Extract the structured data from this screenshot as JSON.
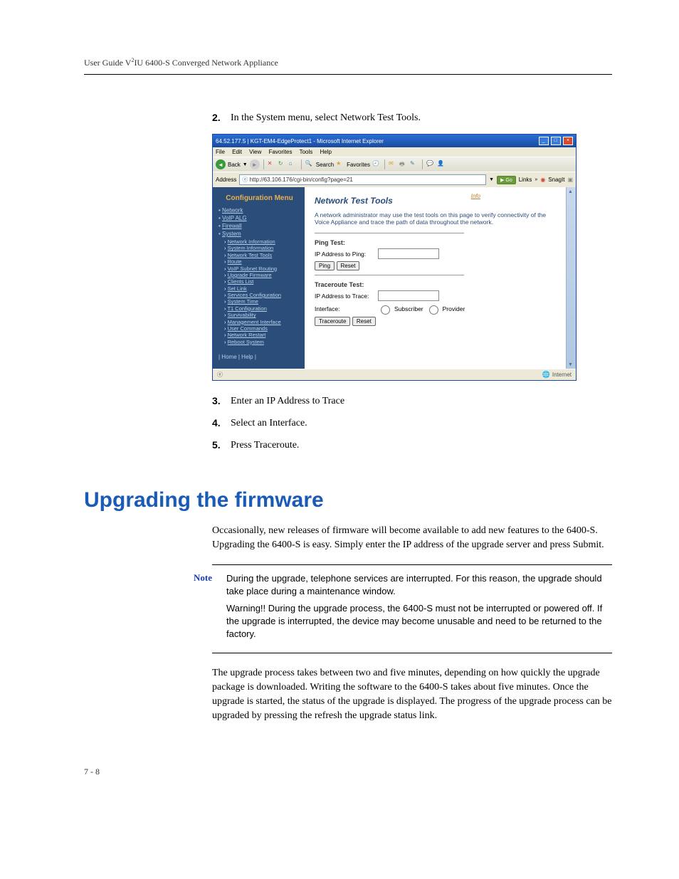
{
  "header": {
    "prefix": "User Guide V",
    "sup": "2",
    "suffix": "IU 6400-S Converged Network Appliance"
  },
  "steps_a": [
    {
      "num": "2.",
      "text": "In the System menu, select Network Test Tools."
    }
  ],
  "steps_b": [
    {
      "num": "3.",
      "text": "Enter an IP Address to Trace"
    },
    {
      "num": "4.",
      "text": "Select an Interface."
    },
    {
      "num": "5.",
      "text": "Press Traceroute."
    }
  ],
  "screenshot": {
    "titlebar": "64.52.177.5 | KGT-EM4-EdgeProtect1 - Microsoft Internet Explorer",
    "menu": {
      "file": "File",
      "edit": "Edit",
      "view": "View",
      "favorites": "Favorites",
      "tools": "Tools",
      "help": "Help"
    },
    "toolbar": {
      "back": "Back",
      "search": "Search",
      "favorites": "Favorites"
    },
    "addressbar": {
      "label": "Address",
      "url": "http://63.106.176/cgi-bin/config?page=21",
      "go": "Go",
      "links": "Links",
      "ext": "SnagIt"
    },
    "sidebar": {
      "title": "Configuration Menu",
      "items": {
        "network": "Network",
        "voip": "VoIP ALG",
        "firewall": "Firewall",
        "system": "System"
      },
      "subs": {
        "netinfo": "Network Information",
        "sysinfo": "System Information",
        "nettest": "Network Test Tools",
        "route": "Route",
        "voip_subnet": "VoIP Subnet Routing",
        "upgrade": "Upgrade Firmware",
        "clients": "Clients List",
        "setlink": "Set Link",
        "services": "Services Configuration",
        "systime": "System Time",
        "t1conf": "T1 Configuration",
        "survive": "Survivability",
        "mgmt": "Management Interface",
        "usercmd": "User Commands",
        "netrestart": "Network Restart",
        "reboot": "Reboot System"
      },
      "footer": "| Home | Help |"
    },
    "main": {
      "title": "Network Test Tools",
      "info": "Info",
      "desc": "A network administrator may use the test tools on this page to verify connectivity of the Voice Appliance and trace the path of data throughout the network.",
      "ping": {
        "title": "Ping Test:",
        "label": "IP Address to Ping:",
        "ping_btn": "Ping",
        "reset_btn": "Reset"
      },
      "trace": {
        "title": "Traceroute Test:",
        "label": "IP Address to Trace:",
        "iface_label": "Interface:",
        "sub": "Subscriber",
        "prov": "Provider",
        "trace_btn": "Traceroute",
        "reset_btn": "Reset"
      }
    },
    "status": {
      "left": "",
      "right": "Internet"
    }
  },
  "heading2": "Upgrading the firmware",
  "para1": "Occasionally, new releases of firmware will become available to add new features to the 6400-S. Upgrading the 6400-S is easy. Simply enter the IP address of the upgrade server and press Submit.",
  "note": {
    "label": "Note",
    "p1": "During the upgrade, telephone services are interrupted. For this reason, the upgrade should take place during a maintenance window.",
    "p2": "Warning!! During the upgrade process, the 6400-S must not be interrupted or powered off. If the upgrade is interrupted, the device may become unusable and need to be returned to the factory."
  },
  "para2": "The upgrade process takes between two and five minutes, depending on how quickly the upgrade package is downloaded. Writing the software to the 6400-S takes about five minutes. Once the upgrade is started, the status of the upgrade is displayed. The progress of the upgrade process can be upgraded by pressing the refresh the upgrade status link.",
  "pagenum": "7 - 8"
}
